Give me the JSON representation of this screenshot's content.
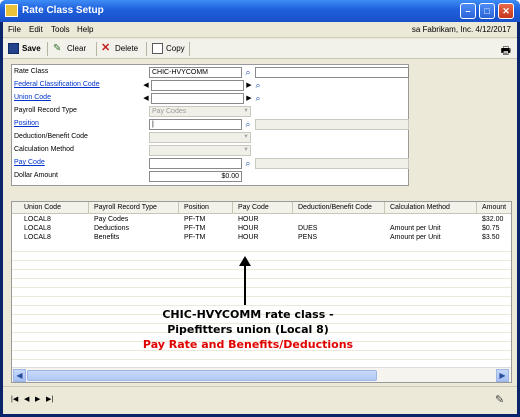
{
  "window": {
    "title": "Rate Class Setup",
    "min": "–",
    "max": "□",
    "close": "✕"
  },
  "menu": {
    "items": [
      "File",
      "Edit",
      "Tools",
      "Help"
    ],
    "user_info": "sa  Fabrikam, Inc.  4/12/2017"
  },
  "toolbar": {
    "save": "Save",
    "clear": "Clear",
    "delete": "Delete",
    "copy": "Copy"
  },
  "form": {
    "rate_class": {
      "label": "Rate Class",
      "value": "CHIC-HVYCOMM"
    },
    "federal_code": {
      "label": "Federal Classification Code",
      "value": ""
    },
    "union_code": {
      "label": "Union Code",
      "value": ""
    },
    "payroll_record_type": {
      "label": "Payroll Record Type",
      "value": "Pay Codes"
    },
    "position": {
      "label": "Position",
      "value": "|"
    },
    "deduction_code": {
      "label": "Deduction/Benefit Code",
      "value": ""
    },
    "calc_method": {
      "label": "Calculation Method",
      "value": ""
    },
    "pay_code": {
      "label": "Pay Code",
      "value": ""
    },
    "dollar_amount": {
      "label": "Dollar Amount",
      "value": "$0.00"
    }
  },
  "grid": {
    "columns": [
      "Union Code",
      "Payroll Record Type",
      "Position",
      "Pay Code",
      "Deduction/Benefit Code",
      "Calculation Method",
      "Amount"
    ],
    "rows": [
      [
        "LOCAL8",
        "Pay Codes",
        "PF-TM",
        "HOUR",
        "",
        "",
        "$32.00"
      ],
      [
        "LOCAL8",
        "Deductions",
        "PF-TM",
        "HOUR",
        "DUES",
        "Amount per Unit",
        "$0.75"
      ],
      [
        "LOCAL8",
        "Benefits",
        "PF-TM",
        "HOUR",
        "PENS",
        "Amount per Unit",
        "$3.50"
      ]
    ]
  },
  "annotation": {
    "line1": "CHIC-HVYCOMM rate class -",
    "line2": "Pipefitters union (Local 8)",
    "line3": "Pay Rate and Benefits/Deductions"
  },
  "navigation": {
    "first": "|◀",
    "prev": "◀",
    "next": "▶",
    "last": "▶|"
  }
}
